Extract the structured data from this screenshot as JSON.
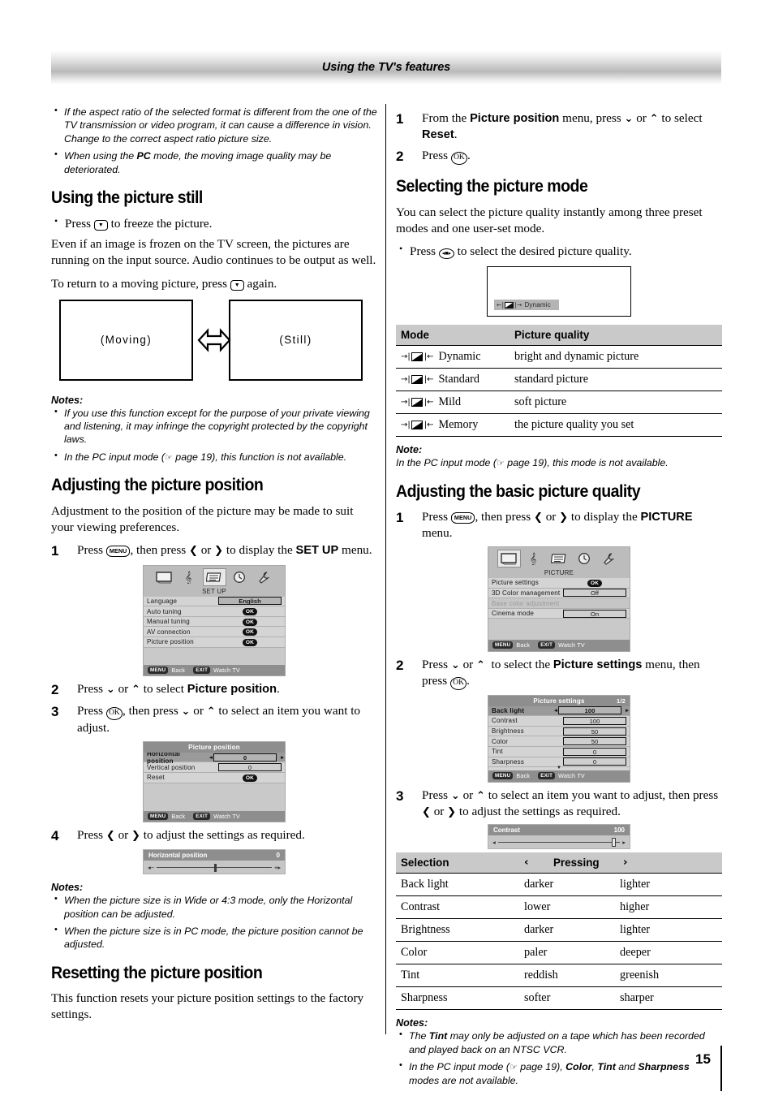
{
  "header": {
    "title": "Using the TV's features"
  },
  "page_number": "15",
  "left": {
    "top_notes": [
      "If the aspect ratio of the selected format is different from the one of the TV transmission or video program, it can cause a difference in vision. Change to the correct aspect ratio picture size.",
      "When using the PC mode, the moving image quality may be deteriorated."
    ],
    "section_still": {
      "heading": "Using the picture still",
      "bullet": "Press ▼ to freeze the picture.",
      "para1": "Even if an image is frozen on the TV screen, the pictures are running on the input source. Audio continues to be output as well.",
      "para2": "To return to a moving picture, press ▼ again.",
      "diagram": {
        "left_label": "(Moving)",
        "right_label": "(Still)"
      },
      "notes_label": "Notes:",
      "notes": [
        "If you use this function except for the purpose of your private viewing and listening, it may infringe the copyright protected by the copyright laws.",
        "In the PC input mode (☞ page 19), this function is not available."
      ]
    },
    "section_position": {
      "heading": "Adjusting the picture position",
      "intro": "Adjustment to the position of the picture may be made to suit your viewing preferences.",
      "step1_num": "1",
      "step1_a": "Press ",
      "step1_key": "MENU",
      "step1_b": ", then press ‹ or › to display the ",
      "step1_bold": "SET UP",
      "step1_c": " menu.",
      "setup_osd": {
        "title": "SET UP",
        "rows": [
          {
            "label": "Language",
            "value": "English",
            "type": "value",
            "selected": true
          },
          {
            "label": "Auto tuning",
            "value": "OK",
            "type": "ok"
          },
          {
            "label": "Manual tuning",
            "value": "OK",
            "type": "ok"
          },
          {
            "label": "AV connection",
            "value": "OK",
            "type": "ok"
          },
          {
            "label": "Picture position",
            "value": "OK",
            "type": "ok"
          }
        ],
        "foot_back_key": "MENU",
        "foot_back": "Back",
        "foot_exit_key": "EXIT",
        "foot_exit": "Watch TV"
      },
      "step2_num": "2",
      "step2_a": "Press ⌄ or ⌃ to select ",
      "step2_bold": "Picture position",
      "step2_b": ".",
      "step3_num": "3",
      "step3_a": "Press ",
      "step3_key": "OK",
      "step3_b": ", then press ⌄ or ⌃ to select an item you want to adjust.",
      "pos_osd": {
        "title": "Picture position",
        "rows": [
          {
            "label": "Horizontal position",
            "value": "0",
            "type": "slider",
            "highlight": true
          },
          {
            "label": "Vertical position",
            "value": "0",
            "type": "value"
          },
          {
            "label": "Reset",
            "value": "OK",
            "type": "ok"
          }
        ],
        "foot_back_key": "MENU",
        "foot_back": "Back",
        "foot_exit_key": "EXIT",
        "foot_exit": "Watch TV"
      },
      "step4_num": "4",
      "step4": "Press ‹ or › to adjust the settings as required.",
      "hpos_slider": {
        "label": "Horizontal position",
        "value": "0",
        "minus": "◂−",
        "plus": "+▸",
        "knob_pct": 50
      },
      "notes_label": "Notes:",
      "notes": [
        "When the picture size is in Wide or 4:3 mode, only the Horizontal position can be adjusted.",
        "When the picture size is in PC mode, the picture position cannot be adjusted."
      ]
    },
    "section_reset": {
      "heading": "Resetting the picture position",
      "para": "This function resets your picture position settings to the factory settings."
    }
  },
  "right": {
    "reset_steps": {
      "step1_num": "1",
      "step1_a": "From the ",
      "step1_bold": "Picture position",
      "step1_b": " menu, press ⌄ or ⌃ to select ",
      "step1_bold2": "Reset",
      "step1_c": ".",
      "step2_num": "2",
      "step2_a": "Press ",
      "step2_key": "OK",
      "step2_b": "."
    },
    "section_mode": {
      "heading": "Selecting the picture mode",
      "intro": "You can select the picture quality instantly among three preset modes and one user-set mode.",
      "bullet_a": "Press ",
      "bullet_key": "picture-mode",
      "bullet_b": " to select the desired picture quality.",
      "popup_label": "Dynamic",
      "table": {
        "headers": [
          "Mode",
          "Picture quality"
        ],
        "rows": [
          {
            "mode": "Dynamic",
            "quality": "bright and dynamic picture"
          },
          {
            "mode": "Standard",
            "quality": "standard picture"
          },
          {
            "mode": "Mild",
            "quality": "soft picture"
          },
          {
            "mode": "Memory",
            "quality": "the picture quality you set"
          }
        ]
      },
      "note_label": "Note:",
      "note": "In the PC input mode (☞ page 19), this mode is not available."
    },
    "section_quality": {
      "heading": "Adjusting the basic picture quality",
      "step1_num": "1",
      "step1_a": "Press ",
      "step1_key": "MENU",
      "step1_b": ", then press ‹ or › to display the ",
      "step1_bold": "PICTURE",
      "step1_c": " menu.",
      "picture_osd": {
        "title": "PICTURE",
        "rows": [
          {
            "label": "Picture settings",
            "value": "OK",
            "type": "ok"
          },
          {
            "label": "3D Color management",
            "value": "Off",
            "type": "value"
          },
          {
            "label": "Base color adjustment",
            "value": "",
            "type": "dim"
          },
          {
            "label": "Cinema mode",
            "value": "On",
            "type": "value"
          }
        ],
        "foot_back_key": "MENU",
        "foot_back": "Back",
        "foot_exit_key": "EXIT",
        "foot_exit": "Watch TV"
      },
      "step2_num": "2",
      "step2_a": "Press ⌄ or ⌃  to select the ",
      "step2_bold": "Picture settings",
      "step2_b": " menu, then press ",
      "step2_key": "OK",
      "step2_c": ".",
      "settings_osd": {
        "title": "Picture settings",
        "page": "1/2",
        "rows": [
          {
            "label": "Back light",
            "value": "100",
            "type": "slider",
            "highlight": true
          },
          {
            "label": "Contrast",
            "value": "100",
            "type": "value"
          },
          {
            "label": "Brightness",
            "value": "50",
            "type": "value"
          },
          {
            "label": "Color",
            "value": "50",
            "type": "value"
          },
          {
            "label": "Tint",
            "value": "0",
            "type": "value"
          },
          {
            "label": "Sharpness",
            "value": "0",
            "type": "value"
          }
        ],
        "foot_back_key": "MENU",
        "foot_back": "Back",
        "foot_exit_key": "EXIT",
        "foot_exit": "Watch TV"
      },
      "step3_num": "3",
      "step3": "Press ⌄ or ⌃ to select an item you want to adjust, then press ‹ or › to adjust the settings as required.",
      "contrast_slider": {
        "label": "Contrast",
        "value": "100",
        "minus": "◂",
        "plus": "▸",
        "knob_pct": 93
      },
      "table": {
        "header_selection": "Selection",
        "header_left_arrow": "‹",
        "header_pressing": "Pressing",
        "header_right_arrow": "›",
        "rows": [
          {
            "selection": "Back light",
            "left": "darker",
            "right": "lighter"
          },
          {
            "selection": "Contrast",
            "left": "lower",
            "right": "higher"
          },
          {
            "selection": "Brightness",
            "left": "darker",
            "right": "lighter"
          },
          {
            "selection": "Color",
            "left": "paler",
            "right": "deeper"
          },
          {
            "selection": "Tint",
            "left": "reddish",
            "right": "greenish"
          },
          {
            "selection": "Sharpness",
            "left": "softer",
            "right": "sharper"
          }
        ]
      },
      "notes_label": "Notes:",
      "notes": [
        "The Tint may only be adjusted on a tape which has been recorded and played back on an NTSC VCR.",
        "In the PC input mode (☞ page 19), Color, Tint and Sharpness modes are not available."
      ]
    }
  }
}
